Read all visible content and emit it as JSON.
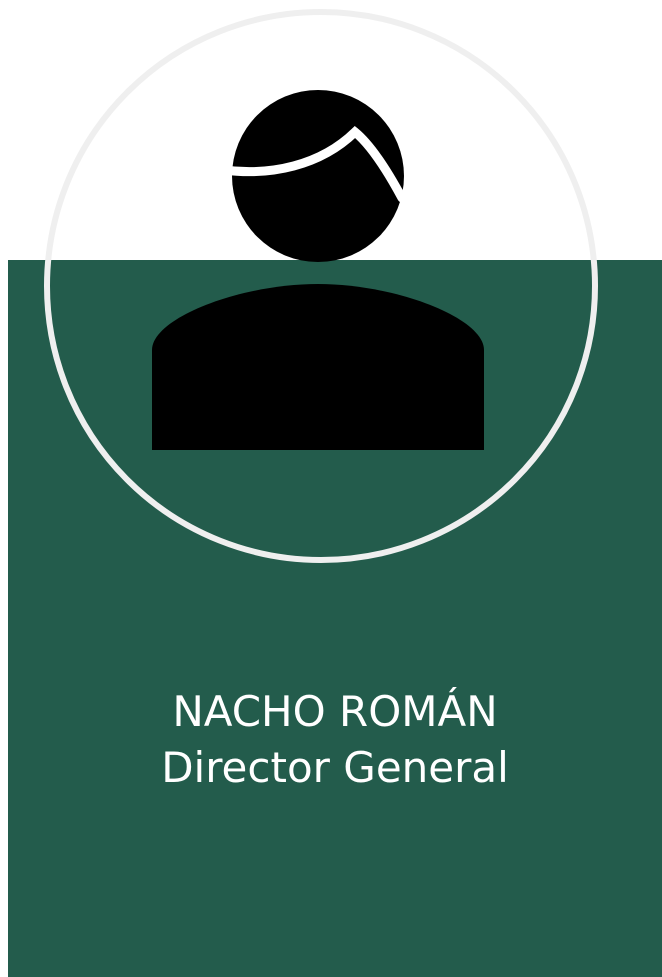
{
  "profile": {
    "name": "NACHO ROMÁN",
    "title": "Director General",
    "avatar_icon": "person-silhouette-icon"
  },
  "colors": {
    "card_background": "#235c4c",
    "ring": "#efefef",
    "text": "#ffffff",
    "silhouette": "#000000"
  }
}
